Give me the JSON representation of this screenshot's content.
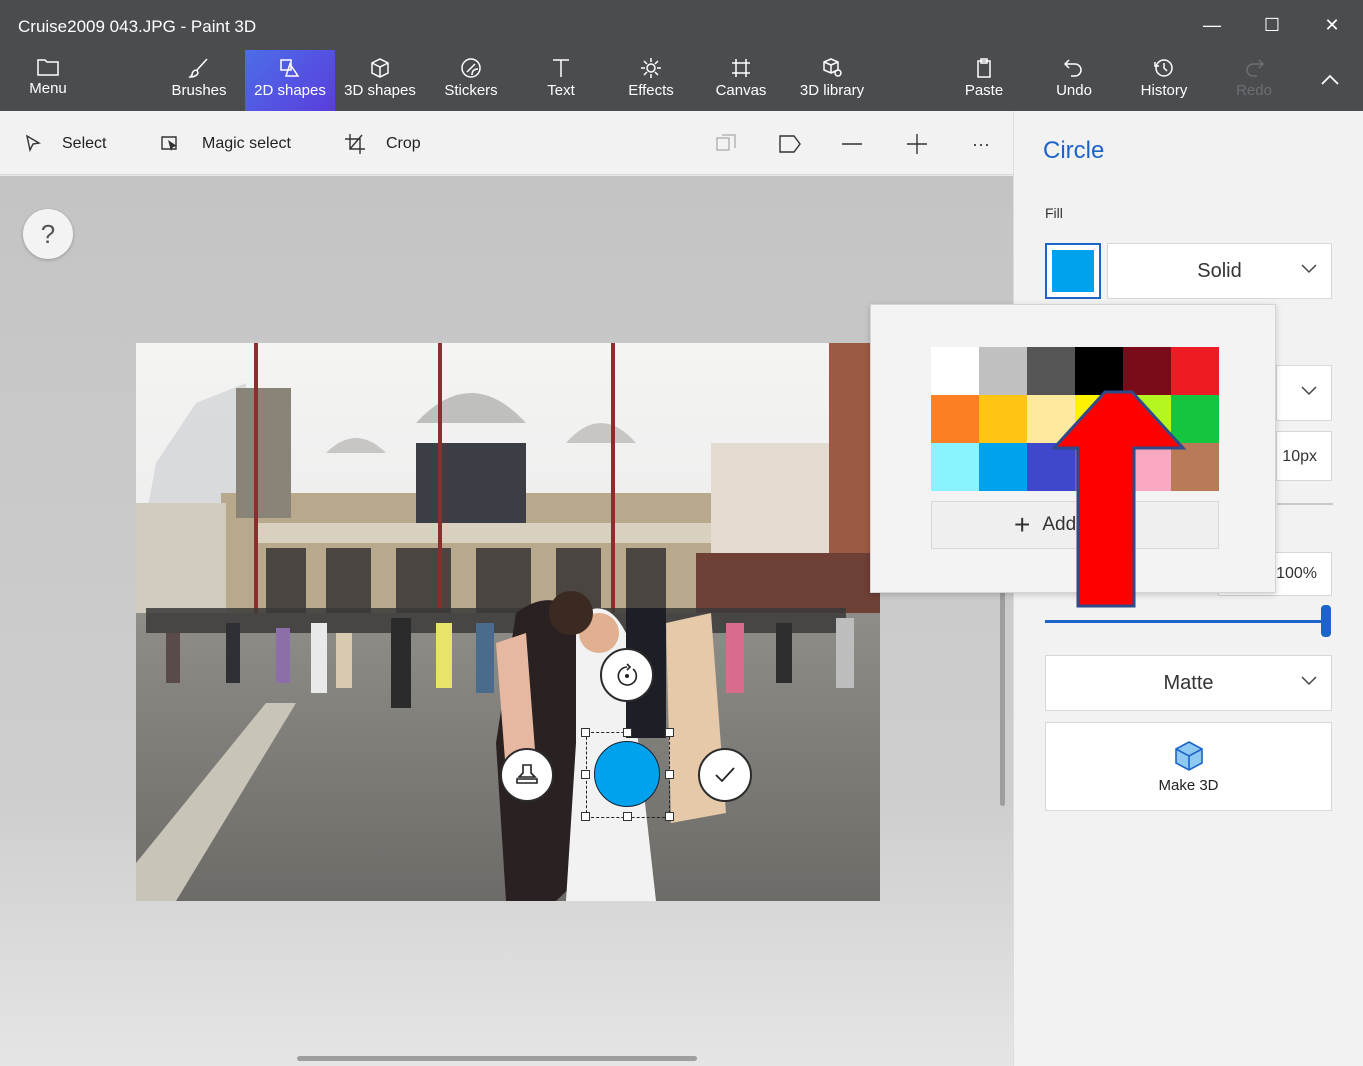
{
  "window": {
    "title": "Cruise2009 043.JPG - Paint 3D",
    "minimize": "—",
    "maximize": "☐",
    "close": "✕"
  },
  "ribbon": {
    "menu": "Menu",
    "tabs": [
      {
        "label": "Brushes",
        "icon": "brush-icon"
      },
      {
        "label": "2D shapes",
        "icon": "2d-shapes-icon",
        "active": true
      },
      {
        "label": "3D shapes",
        "icon": "3d-shapes-icon"
      },
      {
        "label": "Stickers",
        "icon": "stickers-icon"
      },
      {
        "label": "Text",
        "icon": "text-icon"
      },
      {
        "label": "Effects",
        "icon": "effects-icon"
      },
      {
        "label": "Canvas",
        "icon": "canvas-icon"
      },
      {
        "label": "3D library",
        "icon": "3d-library-icon"
      }
    ],
    "paste": "Paste",
    "undo": "Undo",
    "history": "History",
    "redo": "Redo"
  },
  "toolbar": {
    "select": "Select",
    "magic_select": "Magic select",
    "crop": "Crop",
    "more": "···"
  },
  "canvas": {
    "help": "?"
  },
  "panel": {
    "title": "Circle",
    "fill_label": "Fill",
    "fill_color": "#00a2ed",
    "fill_type": "Solid",
    "line_thickness": "10px",
    "opacity": "100%",
    "opacity_value": 1.0,
    "finish": "Matte",
    "make3d": "Make 3D"
  },
  "color_popup": {
    "palette": [
      "#ffffff",
      "#c0c0c0",
      "#555555",
      "#000000",
      "#7a0c1a",
      "#ed1c24",
      "#fd7f23",
      "#ffc414",
      "#fde99e",
      "#fff200",
      "#b5f520",
      "#15c43f",
      "#8af3ff",
      "#00a2ed",
      "#3f48cc",
      "#a349a4",
      "#f8a9c1",
      "#b97a57"
    ],
    "add_label": "Add color"
  },
  "colors": {
    "accent": "#1c64c8",
    "titlebar": "#4a4c50",
    "annotation_arrow": "#ff0000"
  }
}
